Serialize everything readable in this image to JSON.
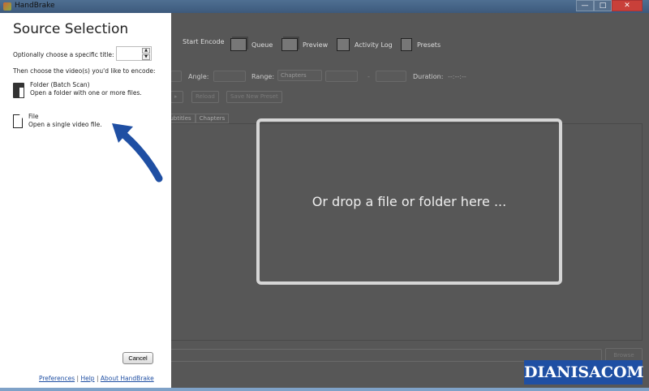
{
  "window": {
    "title": "HandBrake",
    "controls": [
      "minimize",
      "maximize",
      "close"
    ]
  },
  "toolbar": {
    "items": [
      {
        "label": "Start Encode",
        "icon": "play-icon"
      },
      {
        "label": "Queue",
        "icon": "queue-icon"
      },
      {
        "label": "Preview",
        "icon": "preview-icon"
      },
      {
        "label": "Activity Log",
        "icon": "activity-log-icon"
      },
      {
        "label": "Presets",
        "icon": "presets-icon"
      }
    ]
  },
  "source_row": {
    "angle_label": "Angle:",
    "range_label": "Range:",
    "range_value": "Chapters",
    "dash": "-",
    "duration_label": "Duration:",
    "duration_value": "--:--:--"
  },
  "buttons_row": {
    "reload": "Reload",
    "save_preset": "Save New Preset"
  },
  "tabs": [
    "Subtitles",
    "Chapters"
  ],
  "dropzone": {
    "text": "Or drop a file or folder here ..."
  },
  "destination": {
    "browse": "Browse"
  },
  "watermark": "DIANISACOM",
  "source_panel": {
    "title": "Source Selection",
    "title_prompt": "Optionally choose a specific title:",
    "title_value": "",
    "choose_prompt": "Then choose the video(s) you'd like to encode:",
    "options": [
      {
        "name": "Folder (Batch Scan)",
        "desc": "Open a folder with one or more files."
      },
      {
        "name": "File",
        "desc": "Open a single video file."
      }
    ],
    "cancel": "Cancel",
    "links": [
      "Preferences",
      "Help",
      "About HandBrake"
    ],
    "separator": "|"
  }
}
